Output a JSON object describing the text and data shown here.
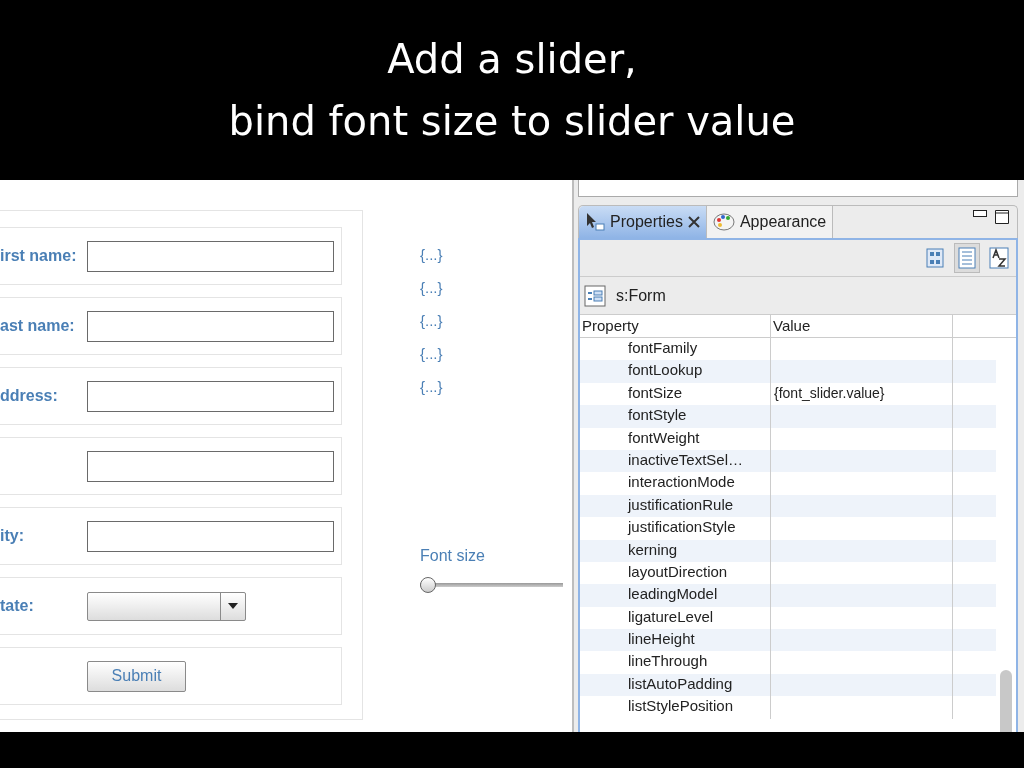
{
  "slide_title": [
    "Add a slider,",
    "bind font size to slider value"
  ],
  "form": {
    "rows": [
      {
        "kind": "input",
        "label": "irst name:"
      },
      {
        "kind": "input",
        "label": "ast name:"
      },
      {
        "kind": "input",
        "label": "ddress:"
      },
      {
        "kind": "input"
      },
      {
        "kind": "input",
        "label": "ity:"
      },
      {
        "kind": "select",
        "label": "tate:"
      },
      {
        "kind": "button",
        "button": "Submit"
      }
    ]
  },
  "bindings": [
    "{...}",
    "{...}",
    "{...}",
    "{...}",
    "{...}"
  ],
  "font_slider": {
    "label": "Font size",
    "level": 0
  },
  "properties_view": {
    "tabs": [
      {
        "label": "Properties",
        "selected": true
      },
      {
        "label": "Appearance",
        "selected": false
      }
    ],
    "toolbar": [
      {
        "kind": "categories",
        "selected": false
      },
      {
        "kind": "list",
        "selected": true
      },
      {
        "kind": "alpha",
        "selected": false
      }
    ],
    "component": "s:Form",
    "columns": [
      "Property",
      "Value"
    ],
    "rows": [
      {
        "property": "fontFamily"
      },
      {
        "property": "fontLookup"
      },
      {
        "property": "fontSize",
        "value": "{font_slider.value}"
      },
      {
        "property": "fontStyle"
      },
      {
        "property": "fontWeight"
      },
      {
        "property": "inactiveTextSel…"
      },
      {
        "property": "interactionMode"
      },
      {
        "property": "justificationRule"
      },
      {
        "property": "justificationStyle"
      },
      {
        "property": "kerning"
      },
      {
        "property": "layoutDirection"
      },
      {
        "property": "leadingModel"
      },
      {
        "property": "ligatureLevel"
      },
      {
        "property": "lineHeight"
      },
      {
        "property": "lineThrough"
      },
      {
        "property": "listAutoPadding"
      },
      {
        "property": "listStylePosition"
      }
    ]
  }
}
